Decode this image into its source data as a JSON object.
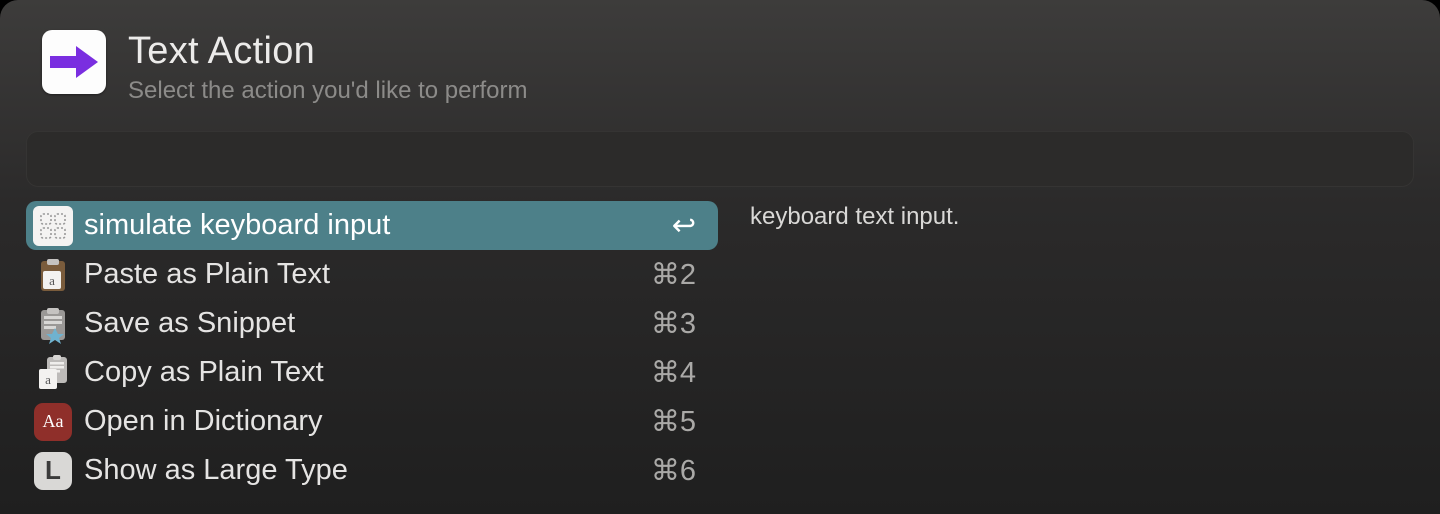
{
  "header": {
    "title": "Text Action",
    "subtitle": "Select the action you'd like to perform"
  },
  "side_description": "keyboard text input.",
  "search_value": "",
  "actions": [
    {
      "label": "simulate keyboard input",
      "shortcut": "↩",
      "selected": true,
      "icon": "keypad-icon"
    },
    {
      "label": "Paste as Plain Text",
      "shortcut": "⌘2",
      "selected": false,
      "icon": "paste-plain-icon"
    },
    {
      "label": "Save as Snippet",
      "shortcut": "⌘3",
      "selected": false,
      "icon": "snippet-star-icon"
    },
    {
      "label": "Copy as Plain Text",
      "shortcut": "⌘4",
      "selected": false,
      "icon": "copy-plain-icon"
    },
    {
      "label": "Open in Dictionary",
      "shortcut": "⌘5",
      "selected": false,
      "icon": "dictionary-icon"
    },
    {
      "label": "Show as Large Type",
      "shortcut": "⌘6",
      "selected": false,
      "icon": "large-type-icon"
    }
  ]
}
